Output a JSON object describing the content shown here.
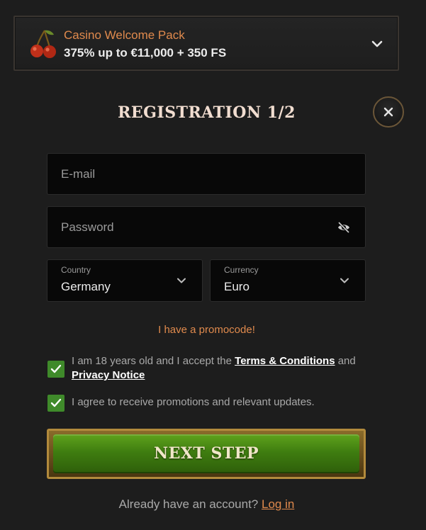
{
  "welcome": {
    "title": "Casino Welcome Pack",
    "offer": "375% up to €11,000 + 350 FS",
    "icon": "cherry-icon"
  },
  "heading": "REGISTRATION 1/2",
  "form": {
    "email": {
      "placeholder": "E-mail",
      "value": ""
    },
    "password": {
      "placeholder": "Password",
      "value": ""
    },
    "country": {
      "label": "Country",
      "value": "Germany"
    },
    "currency": {
      "label": "Currency",
      "value": "Euro"
    }
  },
  "promo_link": "I have a promocode!",
  "consent": {
    "age_prefix": "I am 18 years old and I accept the",
    "terms_link": "Terms & Conditions",
    "and_word": "and",
    "privacy_link": "Privacy Notice",
    "age_checked": true,
    "promotions_text": "I agree to receive promotions and relevant updates.",
    "promotions_checked": true
  },
  "next_button": "NEXT STEP",
  "login": {
    "prompt": "Already have an account?",
    "link": "Log in"
  },
  "colors": {
    "background": "#1d1d1d",
    "accent_orange": "#e08a4d",
    "checkbox_green": "#3f8a2a",
    "button_green": "#4f8f16",
    "button_gold": "#b28a3c"
  }
}
